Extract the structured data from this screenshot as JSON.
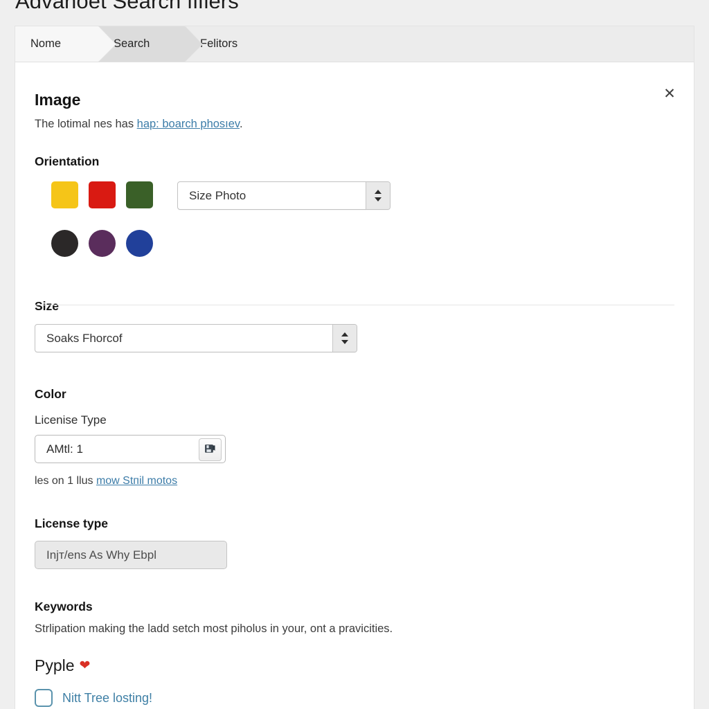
{
  "page": {
    "title": "Advanoet Search fifiers",
    "background_color": "#efefef"
  },
  "tabs": [
    {
      "label": "Nome",
      "active": false
    },
    {
      "label": "Search",
      "active": true
    },
    {
      "label": "Felitors",
      "active": false
    }
  ],
  "close_button": {
    "icon": "close-icon",
    "glyph": "✕"
  },
  "image_section": {
    "title": "Image",
    "desc_plain": "The lotimal nes has ",
    "desc_link": "hap: boarch phosıev",
    "desc_tail": "."
  },
  "orientation": {
    "heading": "Orientation",
    "swatches_square": [
      {
        "name": "swatch-gold",
        "color": "#F5C518"
      },
      {
        "name": "swatch-red",
        "color": "#D91A12"
      },
      {
        "name": "swatch-green",
        "color": "#3A6028"
      }
    ],
    "swatches_circle": [
      {
        "name": "swatch-black",
        "color": "#2B2828"
      },
      {
        "name": "swatch-purple",
        "color": "#5A2D5C"
      },
      {
        "name": "swatch-blue",
        "color": "#21409A"
      }
    ],
    "spinner_value": "Size Photo"
  },
  "size": {
    "heading": "Size",
    "spinner_value": "Soaks Fhorcof"
  },
  "color": {
    "heading": "Color",
    "sub_label": "Licenise Type",
    "input_value": "AMtl: 1",
    "icon_button": "save-disk-icon",
    "helper_plain": "les on 1 llus ",
    "helper_link": "mow Stпil motos"
  },
  "license": {
    "heading": "License type",
    "input_placeholder": "Injт/ens As Why Ebpl"
  },
  "keywords": {
    "heading": "Keywords",
    "description": "Strlipation making the ladd setch most piholʋs in your, ont a pravicities."
  },
  "footer": {
    "pyple_label": "Pyple",
    "heart_glyph": "❤",
    "heart_color": "#D93025",
    "check_label": "Nitt Tree losting!",
    "checked": false
  },
  "colors": {
    "link": "#3c7ca8",
    "panel": "#ffffff",
    "tabbar": "#ececec",
    "tab_active": "#dcdcdc"
  }
}
